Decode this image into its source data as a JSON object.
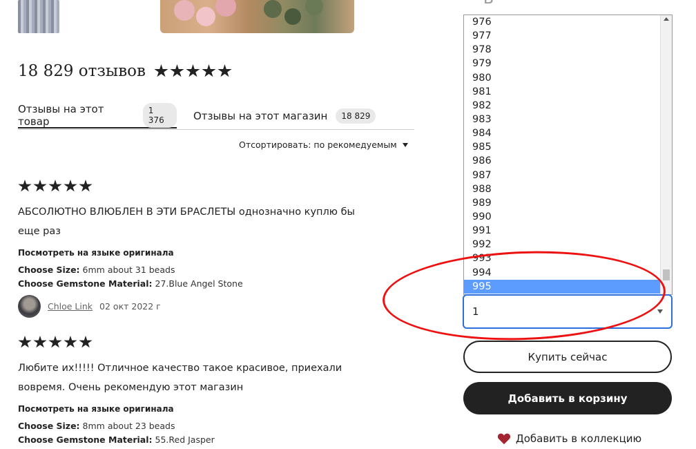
{
  "gallery": {
    "thumb_alt": "bracelet thumbnail",
    "hero_alt": "bracelets on wood"
  },
  "reviews_header": {
    "title": "18 829 отзывов",
    "rating": 5
  },
  "tabs": [
    {
      "label": "Отзывы на этот товар",
      "count": "1 376",
      "active": true
    },
    {
      "label": "Отзывы на этот магазин",
      "count": "18 829",
      "active": false
    }
  ],
  "sort": {
    "label": "Отсортировать: по рекомедуемым"
  },
  "reviews": [
    {
      "rating": 5,
      "text": "АБСОЛЮТНО ВЛЮБЛЕН В ЭТИ БРАСЛЕТЫ однозначно куплю бы еще раз",
      "translate_label": "Посмотреть на языке оригинала",
      "size_label": "Choose Size:",
      "size_value": "6mm about 31 beads",
      "material_label": "Choose Gemstone Material:",
      "material_value": "27.Blue Angel Stone",
      "author": "Chloe Link",
      "date": "02 окт 2022 г"
    },
    {
      "rating": 5,
      "text": "Любите их!!!!! Отличное качество такое красивое, приехали вовремя. Очень рекомендую этот магазин",
      "translate_label": "Посмотреть на языке оригинала",
      "size_label": "Choose Size:",
      "size_value": "8mm about 23 beads",
      "material_label": "Choose Gemstone Material:",
      "material_value": "55.Red Jasper"
    }
  ],
  "quantity_dropdown": {
    "options": [
      "976",
      "977",
      "978",
      "979",
      "980",
      "981",
      "982",
      "983",
      "984",
      "985",
      "986",
      "987",
      "988",
      "989",
      "990",
      "991",
      "992",
      "993",
      "994",
      "995"
    ],
    "selected_option": "995",
    "current_value": "1"
  },
  "actions": {
    "buy_now": "Купить сейчас",
    "add_to_cart": "Добавить в корзину",
    "add_to_collection": "Добавить в коллекцию"
  },
  "colors": {
    "accent_blue": "#5d9cff",
    "focus_border": "#2a6fdb",
    "annotation_red": "#e11111",
    "heart": "#a3232e"
  }
}
